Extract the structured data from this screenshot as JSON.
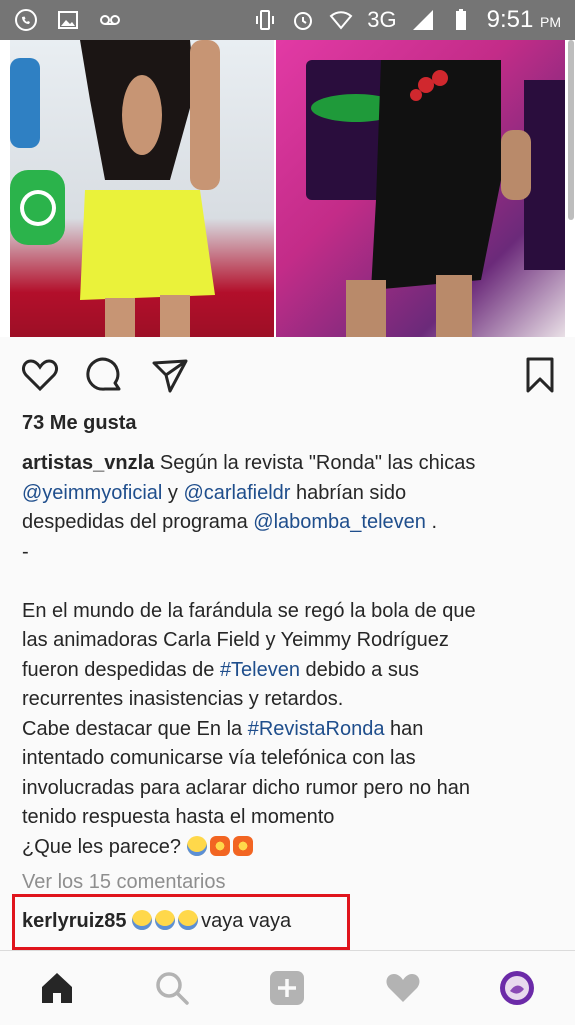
{
  "status_bar": {
    "network": "3G",
    "time": "9:51",
    "ampm": "PM"
  },
  "post": {
    "likes": "73 Me gusta",
    "username": "artistas_vnzla",
    "caption": {
      "l1_text": " Según la revista \"Ronda\" las chicas",
      "l2_mention1": "@yeimmyoficial",
      "l2_mid": " y ",
      "l2_mention2": "@carlafieldr",
      "l2_end": " habrían sido",
      "l3_start": "despedidas del programa ",
      "l3_mention": "@labomba_televen",
      "l3_end": " .",
      "l4": "-",
      "l6": "En el mundo de la farándula se regó la bola de que",
      "l7": "las animadoras Carla Field y Yeimmy Rodríguez",
      "l8_start": "fueron despedidas de  ",
      "l8_tag": "#Televen",
      "l8_end": " debido a sus",
      "l9": "recurrentes inasistencias y retardos.",
      "l10_start": "Cabe destacar que En la ",
      "l10_tag": "#RevistaRonda",
      "l10_end": " han",
      "l11": "intentado comunicarse vía telefónica con las",
      "l12": "involucradas para aclarar dicho rumor pero no han",
      "l13": "tenido respuesta hasta el momento",
      "l14": "¿Que les parece? "
    },
    "view_comments": "Ver los 15 comentarios",
    "comment": {
      "username": "kerlyruiz85",
      "text": "vaya vaya"
    }
  },
  "colors": {
    "highlight_box": "#e0141c",
    "mention": "#1f4e8c"
  },
  "icons": {
    "actions": [
      "heart-icon",
      "comment-icon",
      "share-icon",
      "bookmark-icon"
    ],
    "nav": [
      "home-icon",
      "search-icon",
      "add-post-icon",
      "activity-heart-icon",
      "profile-avatar"
    ]
  }
}
